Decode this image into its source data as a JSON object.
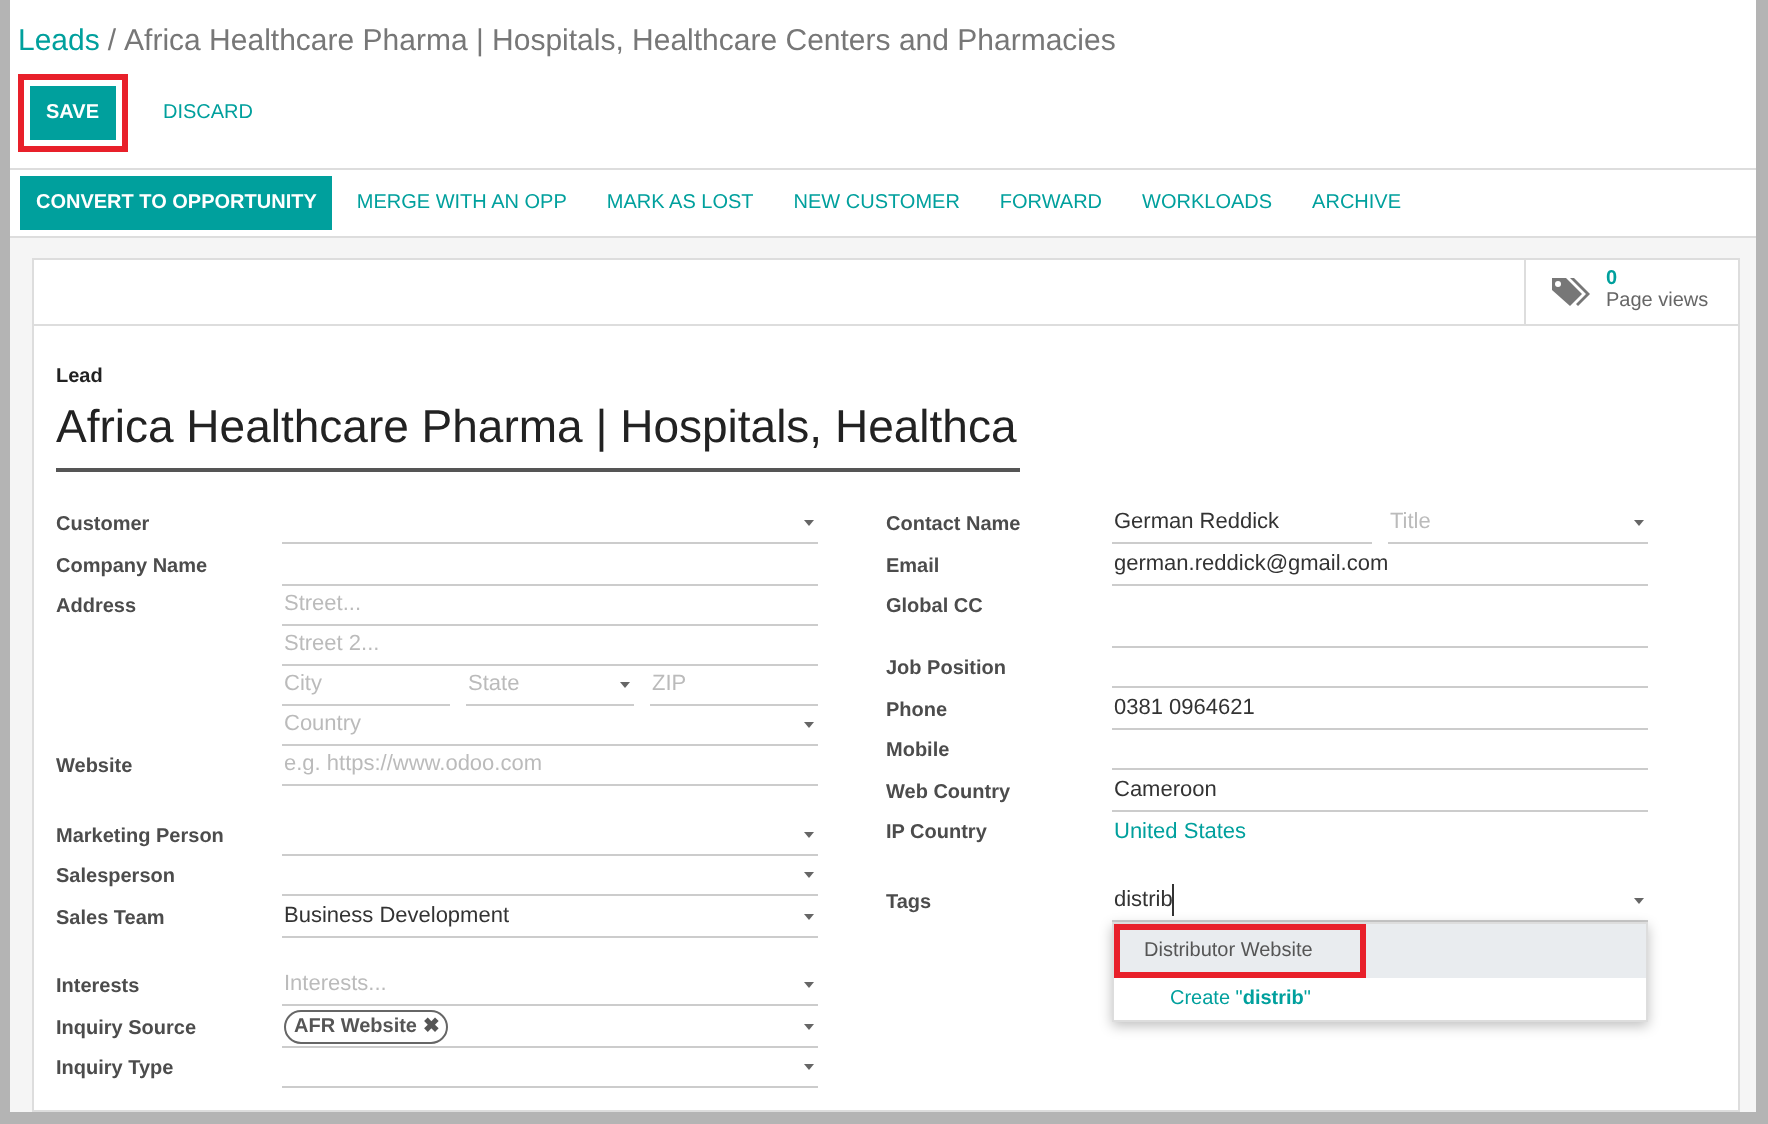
{
  "breadcrumb": {
    "parent": "Leads",
    "separator": "/",
    "current": "Africa Healthcare Pharma | Hospitals, Healthcare Centers and Pharmacies"
  },
  "buttons": [
    {
      "label": "SAVE",
      "kind": "primary",
      "highlighted": true
    },
    {
      "label": "DISCARD",
      "kind": "link",
      "highlighted": false
    }
  ],
  "header_buttons": [
    {
      "label": "CONVERT TO OPPORTUNITY",
      "kind": "primary"
    },
    {
      "label": "MERGE WITH AN OPP",
      "kind": "link"
    },
    {
      "label": "MARK AS LOST",
      "kind": "link"
    },
    {
      "label": "NEW CUSTOMER",
      "kind": "link"
    },
    {
      "label": "FORWARD",
      "kind": "link"
    },
    {
      "label": "WORKLOADS",
      "kind": "link"
    },
    {
      "label": "ARCHIVE",
      "kind": "link"
    }
  ],
  "smart_button": {
    "count": "0",
    "label": "Page views"
  },
  "lead": {
    "label": "Lead",
    "name": "Africa Healthcare Pharma | Hospitals, Healthca"
  },
  "left_groups": [
    [
      {
        "label": "Customer",
        "lines": [
          [
            {
              "kind": "select"
            }
          ]
        ]
      },
      {
        "label": "Company Name",
        "lines": [
          [
            {
              "kind": "text"
            }
          ]
        ]
      },
      {
        "label": "Address",
        "lines": [
          [
            {
              "kind": "text",
              "placeholder": "Street..."
            }
          ],
          [
            {
              "kind": "text",
              "placeholder": "Street 2..."
            }
          ],
          [
            {
              "kind": "text",
              "placeholder": "City"
            },
            {
              "kind": "select",
              "placeholder": "State"
            },
            {
              "kind": "text",
              "placeholder": "ZIP"
            }
          ],
          [
            {
              "kind": "select",
              "placeholder": "Country"
            }
          ]
        ]
      },
      {
        "label": "Website",
        "lines": [
          [
            {
              "kind": "text",
              "placeholder": "e.g. https://www.odoo.com"
            }
          ]
        ]
      }
    ],
    [
      {
        "label": "Marketing Person",
        "lines": [
          [
            {
              "kind": "select"
            }
          ]
        ]
      },
      {
        "label": "Salesperson",
        "lines": [
          [
            {
              "kind": "select"
            }
          ]
        ]
      },
      {
        "label": "Sales Team",
        "lines": [
          [
            {
              "kind": "select",
              "value": "Business Development"
            }
          ]
        ]
      }
    ],
    [
      {
        "label": "Interests",
        "lines": [
          [
            {
              "kind": "select",
              "placeholder": "Interests..."
            }
          ]
        ]
      },
      {
        "label": "Inquiry Source",
        "lines": [
          [
            {
              "kind": "select",
              "tags": [
                {
                  "label": "AFR Website",
                  "remove": "✖"
                }
              ]
            }
          ]
        ]
      },
      {
        "label": "Inquiry Type",
        "lines": [
          [
            {
              "kind": "select"
            }
          ]
        ]
      }
    ]
  ],
  "right_groups": [
    [
      {
        "label": "Contact Name",
        "lines": [
          [
            {
              "kind": "text",
              "value": "German Reddick"
            },
            {
              "kind": "select",
              "placeholder": "Title"
            }
          ]
        ]
      },
      {
        "label": "Email",
        "lines": [
          [
            {
              "kind": "text",
              "value": "german.reddick@gmail.com"
            }
          ]
        ]
      },
      {
        "label": "Global CC",
        "lines": [
          [
            {
              "kind": "textarea"
            }
          ]
        ]
      },
      {
        "label": "Job Position",
        "lines": [
          [
            {
              "kind": "text"
            }
          ]
        ]
      },
      {
        "label": "Phone",
        "lines": [
          [
            {
              "kind": "text",
              "value": "0381 0964621"
            }
          ]
        ]
      },
      {
        "label": "Mobile",
        "lines": [
          [
            {
              "kind": "text"
            }
          ]
        ]
      },
      {
        "label": "Web Country",
        "lines": [
          [
            {
              "kind": "text",
              "value": "Cameroon"
            }
          ]
        ]
      },
      {
        "label": "IP Country",
        "lines": [
          [
            {
              "kind": "link",
              "value": "United States"
            }
          ]
        ]
      }
    ],
    [
      {
        "label": "Tags",
        "lines": [
          [
            {
              "kind": "select",
              "value": "distrib",
              "focused": true,
              "dropdown": [
                {
                  "label": "Distributor Website",
                  "kind": "option",
                  "selected": true,
                  "highlighted": true
                },
                {
                  "label": "Create \"**distrib**\"",
                  "kind": "create",
                  "selected": false,
                  "highlighted": false
                }
              ]
            }
          ]
        ]
      }
    ]
  ]
}
